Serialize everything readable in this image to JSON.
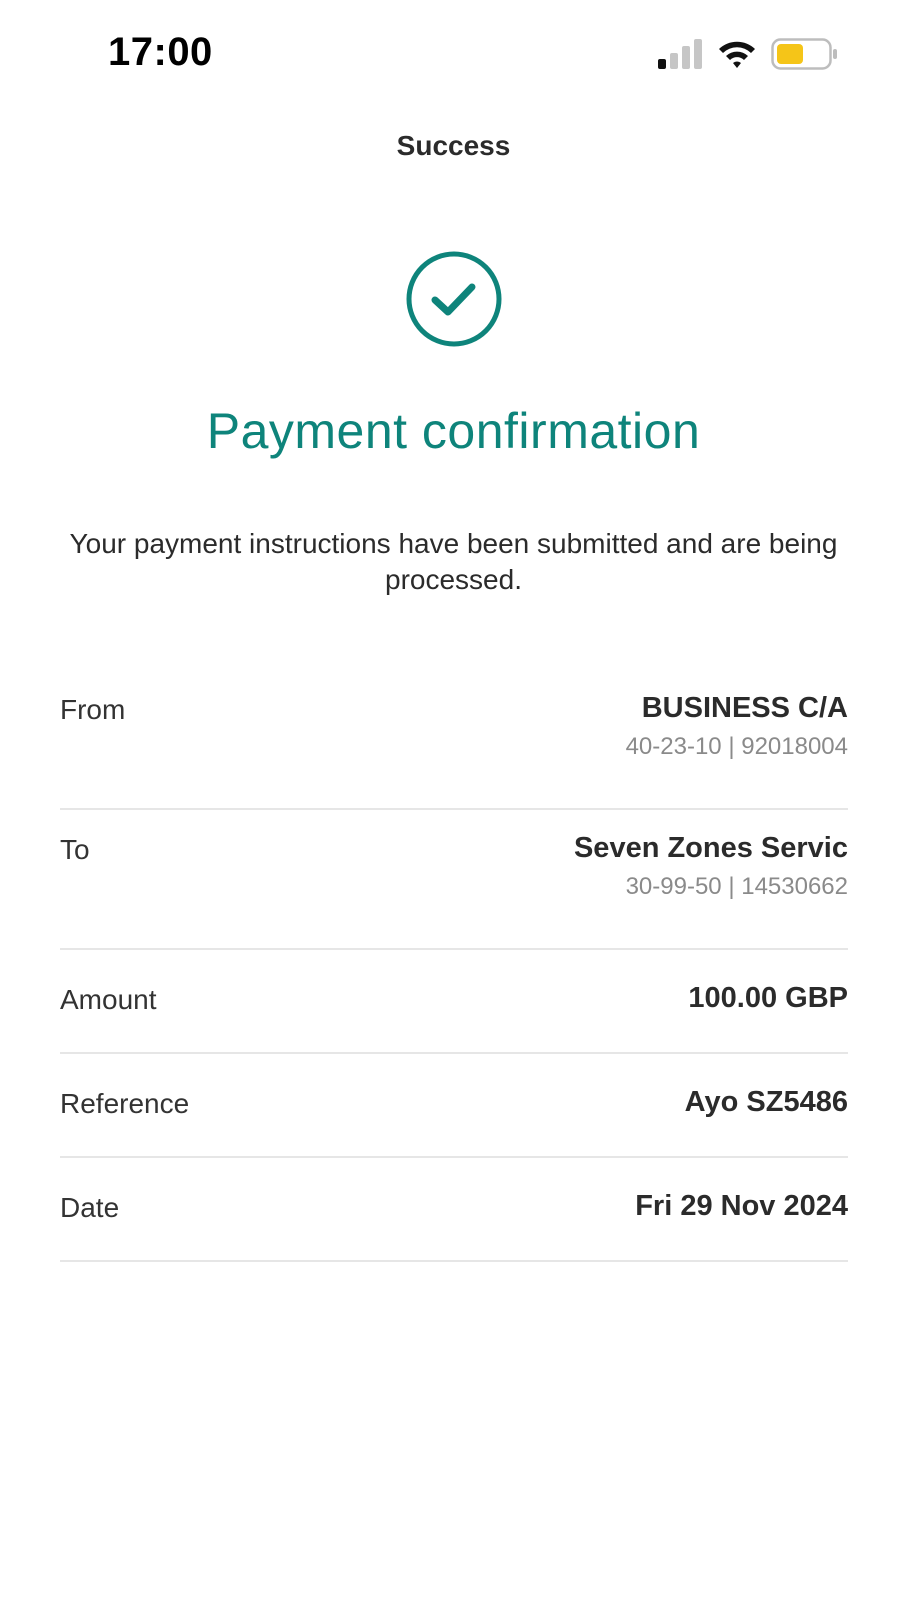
{
  "status_bar": {
    "time": "17:00",
    "icons": [
      "cellular-signal-icon",
      "wifi-icon",
      "battery-icon"
    ],
    "battery_color": "#f5c518"
  },
  "nav": {
    "title": "Success"
  },
  "confirmation": {
    "icon": "check-circle-icon",
    "accent_color": "#0e847b",
    "headline": "Payment confirmation",
    "message": "Your payment instructions have been submitted and are being processed."
  },
  "details": {
    "from": {
      "label": "From",
      "value": "BUSINESS C/A",
      "sub": "40-23-10 | 92018004"
    },
    "to": {
      "label": "To",
      "value": "Seven Zones Servic",
      "sub": "30-99-50 | 14530662"
    },
    "amount": {
      "label": "Amount",
      "value": "100.00 GBP"
    },
    "reference": {
      "label": "Reference",
      "value": "Ayo SZ5486"
    },
    "date": {
      "label": "Date",
      "value": "Fri 29 Nov 2024"
    }
  }
}
